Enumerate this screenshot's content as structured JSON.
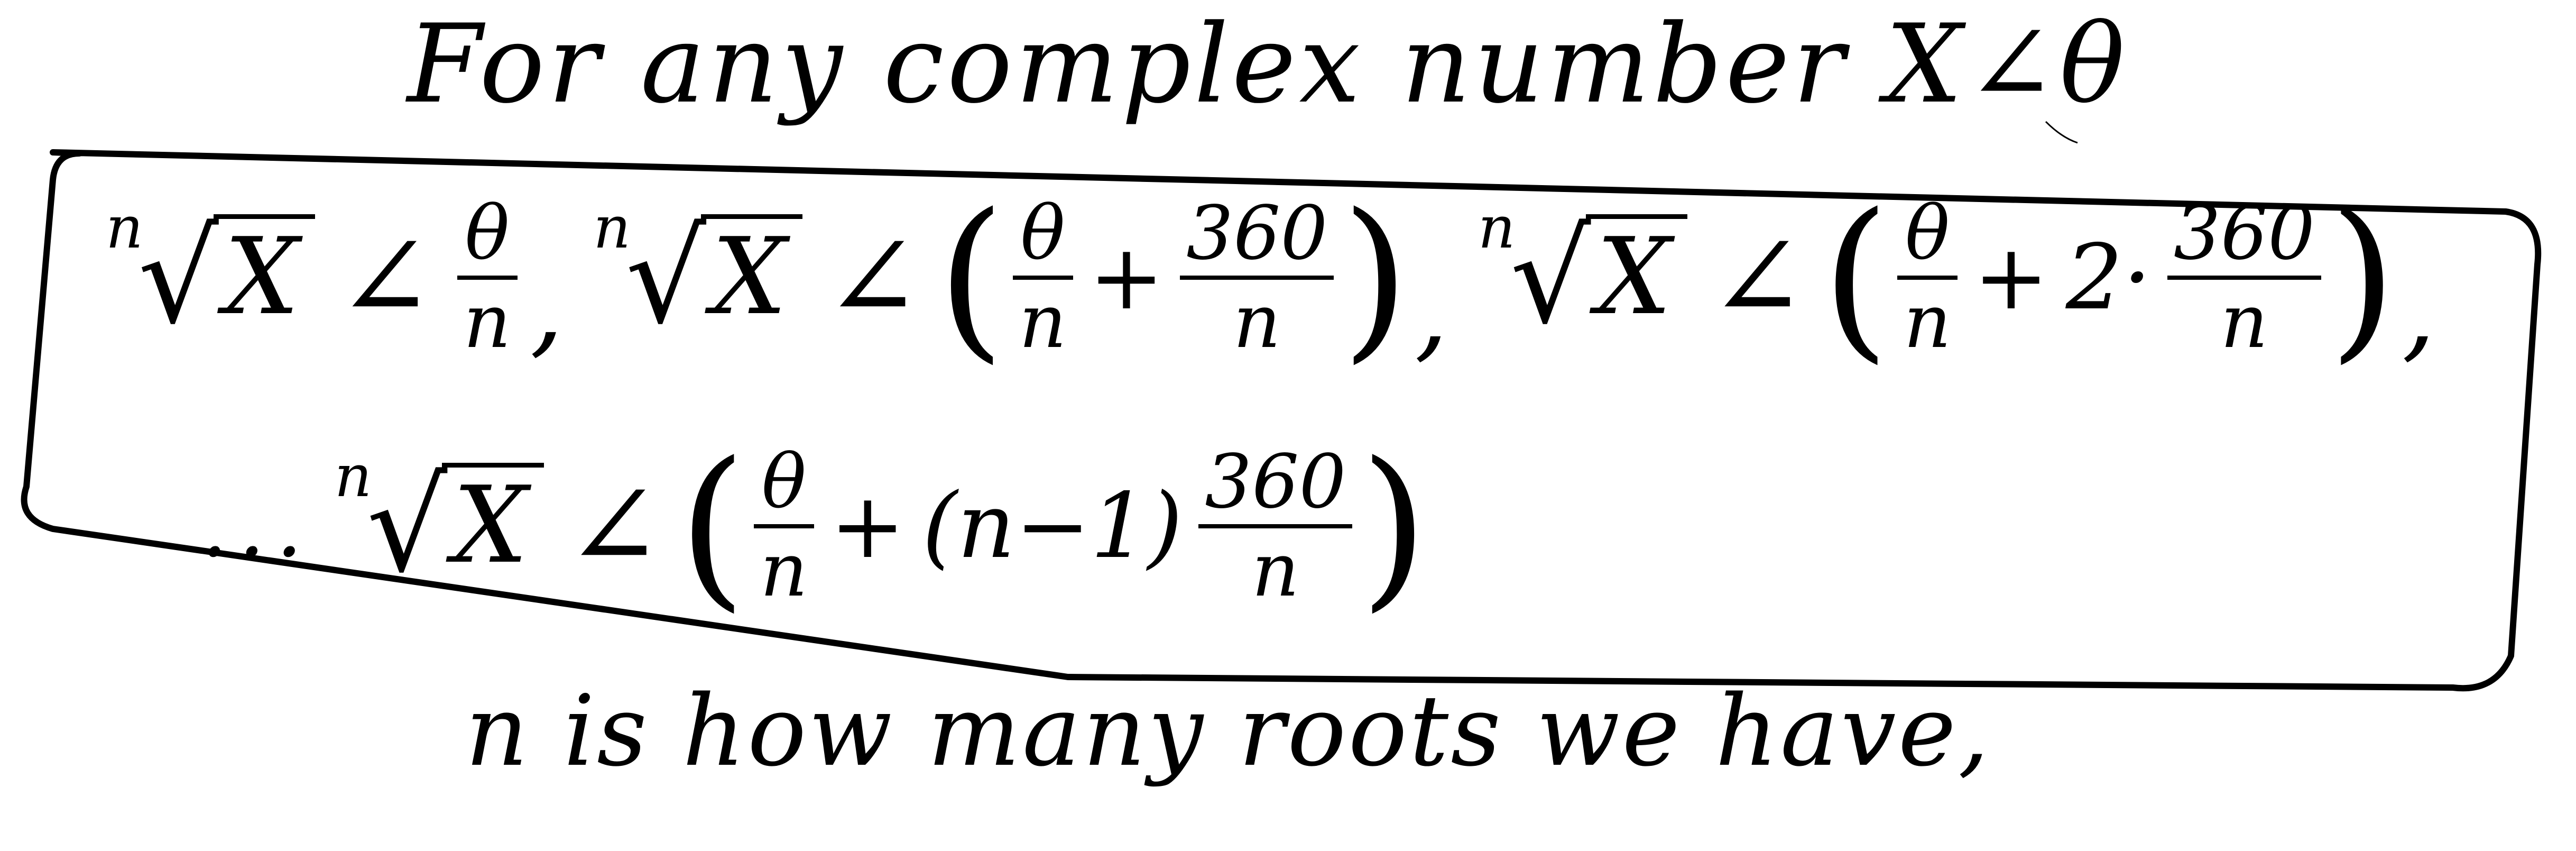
{
  "header": {
    "text": "For any complex number X∠θ"
  },
  "formula": {
    "root_index": "n",
    "radicand": "X",
    "angle_symbol": "∠",
    "theta": "θ",
    "n_denominator": "n",
    "value_360": "360",
    "plus": "+",
    "comma": ",",
    "coef_2": "2·",
    "coef_n_minus_1": "(n−1)",
    "ellipsis": "...",
    "open_paren": "(",
    "close_paren": ")"
  },
  "footer": {
    "text": "n is how many roots we have,"
  }
}
